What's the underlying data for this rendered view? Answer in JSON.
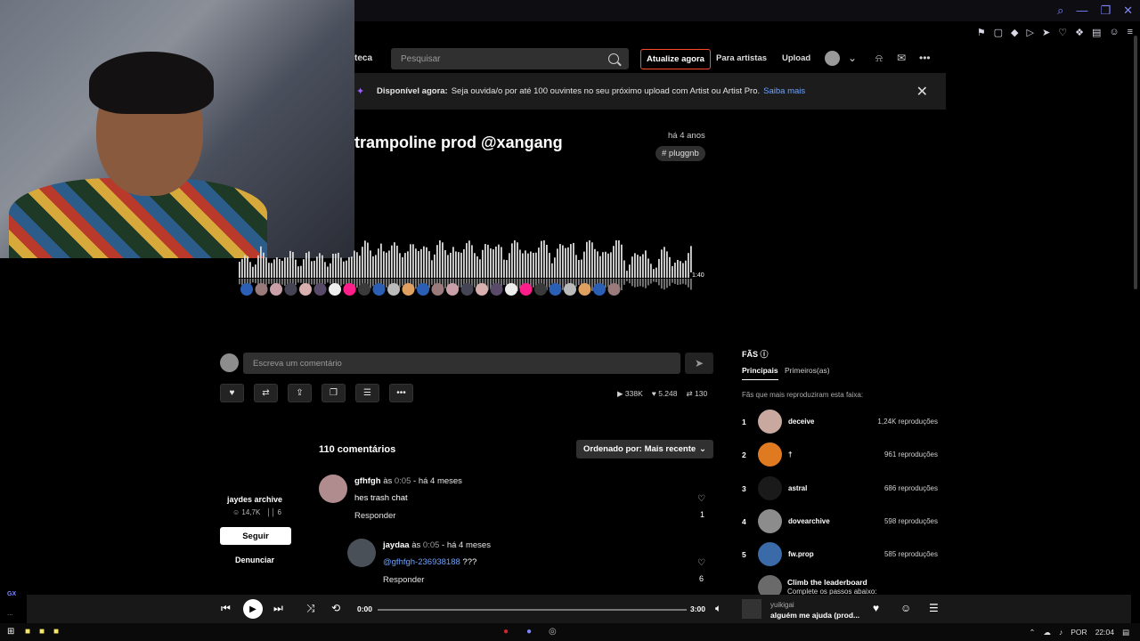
{
  "header": {
    "library_fragment": "teca",
    "search_placeholder": "Pesquisar",
    "upgrade_label": "Atualize agora",
    "for_artists_label": "Para artistas",
    "upload_label": "Upload"
  },
  "banner": {
    "bold": "Disponível agora:",
    "text": "Seja ouvida/o por até 100 ouvintes no seu próximo upload com Artist ou Artist Pro.",
    "link": "Saiba mais"
  },
  "track": {
    "title": "trampoline prod @xangang",
    "posted": "há 4 anos",
    "tag": "# pluggnb",
    "duration": "1:40"
  },
  "comment_input": {
    "placeholder": "Escreva um comentário"
  },
  "stats": {
    "plays": "338K",
    "likes": "5.248",
    "reposts": "130"
  },
  "uploader": {
    "name": "jaydes archive",
    "followers": "14,7K",
    "tracks": "6",
    "follow_label": "Seguir",
    "report_label": "Denunciar"
  },
  "comments": {
    "count_label": "110 comentários",
    "sort_label": "Ordenado por: Mais recente",
    "items": [
      {
        "user": "gfhfgh",
        "at": "às",
        "time": "0:05",
        "ago": "- há 4 meses",
        "body": "hes trash chat",
        "reply": "Responder",
        "likes": "1"
      },
      {
        "user": "jaydaa",
        "at": "às",
        "time": "0:05",
        "ago": "- há 4 meses",
        "mention": "@gfhfgh-236938188",
        "body": " ???",
        "reply": "Responder",
        "likes": "6"
      }
    ]
  },
  "fans": {
    "title": "FÃS",
    "tab_top": "Principais",
    "tab_first": "Primeiros(as)",
    "subtitle": "Fãs que mais reproduziram esta faixa:",
    "items": [
      {
        "rank": "1",
        "name": "deceive",
        "plays": "1,24K reproduções",
        "color": "#c9a8a0"
      },
      {
        "rank": "2",
        "name": "†",
        "plays": "961 reproduções",
        "color": "#e07a20"
      },
      {
        "rank": "3",
        "name": "astral",
        "plays": "686 reproduções",
        "color": "#1a1a1a"
      },
      {
        "rank": "4",
        "name": "dovearchive",
        "plays": "598 reproduções",
        "color": "#8c8c8c"
      },
      {
        "rank": "5",
        "name": "fw.prop",
        "plays": "585 reproduções",
        "color": "#3a6aa8"
      }
    ],
    "climb_title": "Climb the leaderboard",
    "climb_sub": "Complete os passos abaixo:"
  },
  "player": {
    "elapsed": "0:00",
    "total": "3:00",
    "artist": "yuikigai",
    "track": "alguém me ajuda (prod..."
  },
  "taskbar": {
    "lang": "POR",
    "clock": "22:04"
  },
  "sidebar": {
    "gx": "GX",
    "dots": "..."
  },
  "colors": {
    "accent": "#ff4b2b",
    "link": "#6ea3ff",
    "opera": "#7e86ff"
  }
}
